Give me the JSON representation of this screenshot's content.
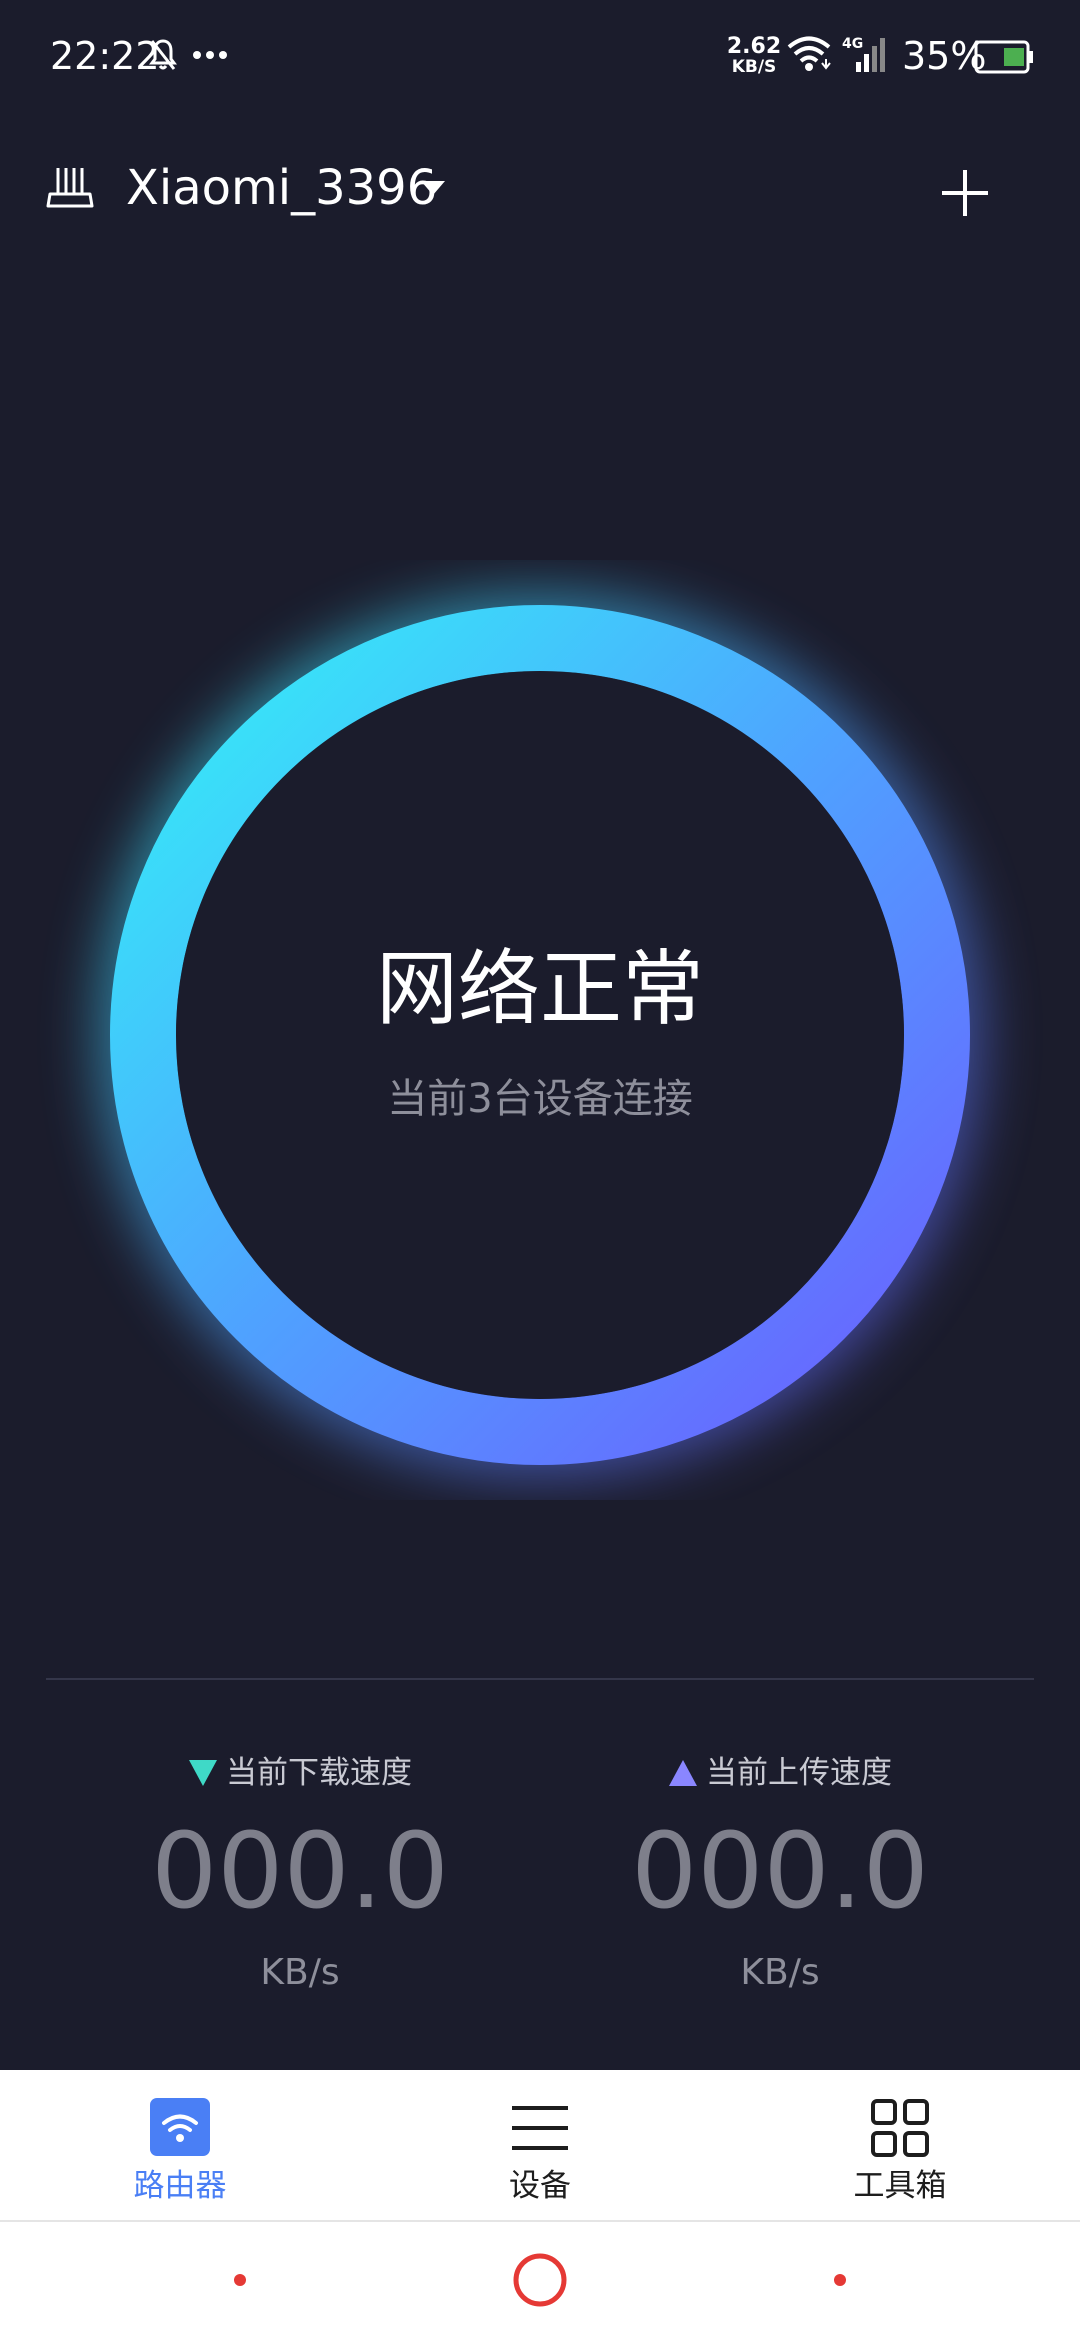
{
  "status_bar": {
    "time": "22:22",
    "net_speed_value": "2.62",
    "net_speed_unit": "KB/S",
    "network_type": "4G",
    "battery": "35%"
  },
  "header": {
    "router_name": "Xiaomi_3396"
  },
  "status": {
    "title": "网络正常",
    "subtitle": "当前3台设备连接"
  },
  "download": {
    "label": "当前下载速度",
    "value": "000.0",
    "unit": "KB/s"
  },
  "upload": {
    "label": "当前上传速度",
    "value": "000.0",
    "unit": "KB/s"
  },
  "bottom_nav": [
    {
      "label": "路由器",
      "icon": "wifi-icon",
      "active": true
    },
    {
      "label": "设备",
      "icon": "menu-icon",
      "active": false
    },
    {
      "label": "工具箱",
      "icon": "grid-icon",
      "active": false
    }
  ],
  "colors": {
    "background": "#1b1c2c",
    "ring_start": "#33f2f7",
    "ring_end": "#6c5cff",
    "download_arrow": "#3fd9c7",
    "upload_arrow": "#8a86ff",
    "active_tab": "#4a7ff5",
    "system_nav": "#e53935"
  }
}
